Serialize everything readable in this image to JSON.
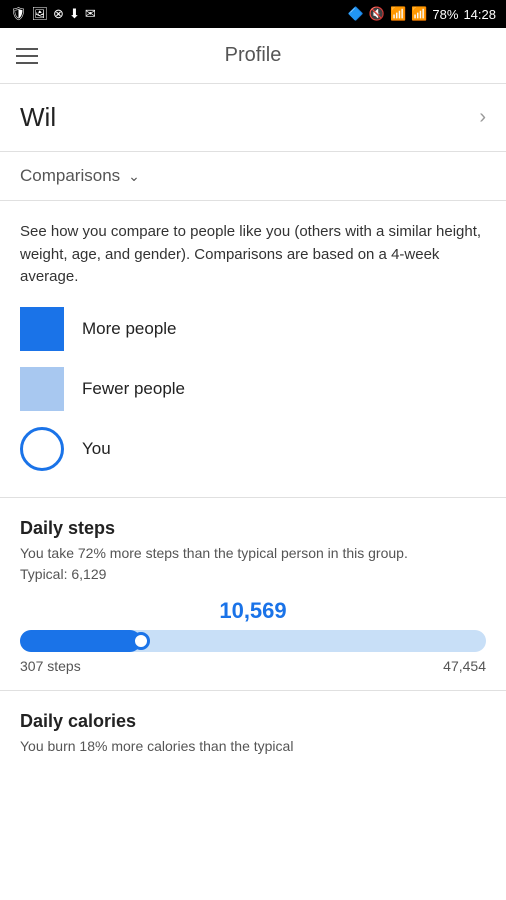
{
  "status_bar": {
    "battery": "78%",
    "time": "14:28"
  },
  "header": {
    "title": "Profile",
    "menu_icon": "hamburger-icon"
  },
  "profile": {
    "name": "Wil",
    "chevron": "›"
  },
  "comparisons": {
    "label": "Comparisons",
    "chevron": "∨"
  },
  "legend": {
    "description": "See how you compare to people like you (others with a similar height, weight, age, and gender). Comparisons are based on a 4-week average.",
    "items": [
      {
        "type": "more-people",
        "label": "More people"
      },
      {
        "type": "fewer-people",
        "label": "Fewer people"
      },
      {
        "type": "you",
        "label": "You"
      }
    ]
  },
  "daily_steps": {
    "title": "Daily steps",
    "description": "You take 72% more steps than the typical person in this group.",
    "typical_label": "Typical: 6,129",
    "value": "10,569",
    "range_min": "307 steps",
    "range_max": "47,454",
    "progress_pct": 26
  },
  "daily_calories": {
    "title": "Daily calories",
    "description": "You burn 18% more calories than the typical"
  }
}
